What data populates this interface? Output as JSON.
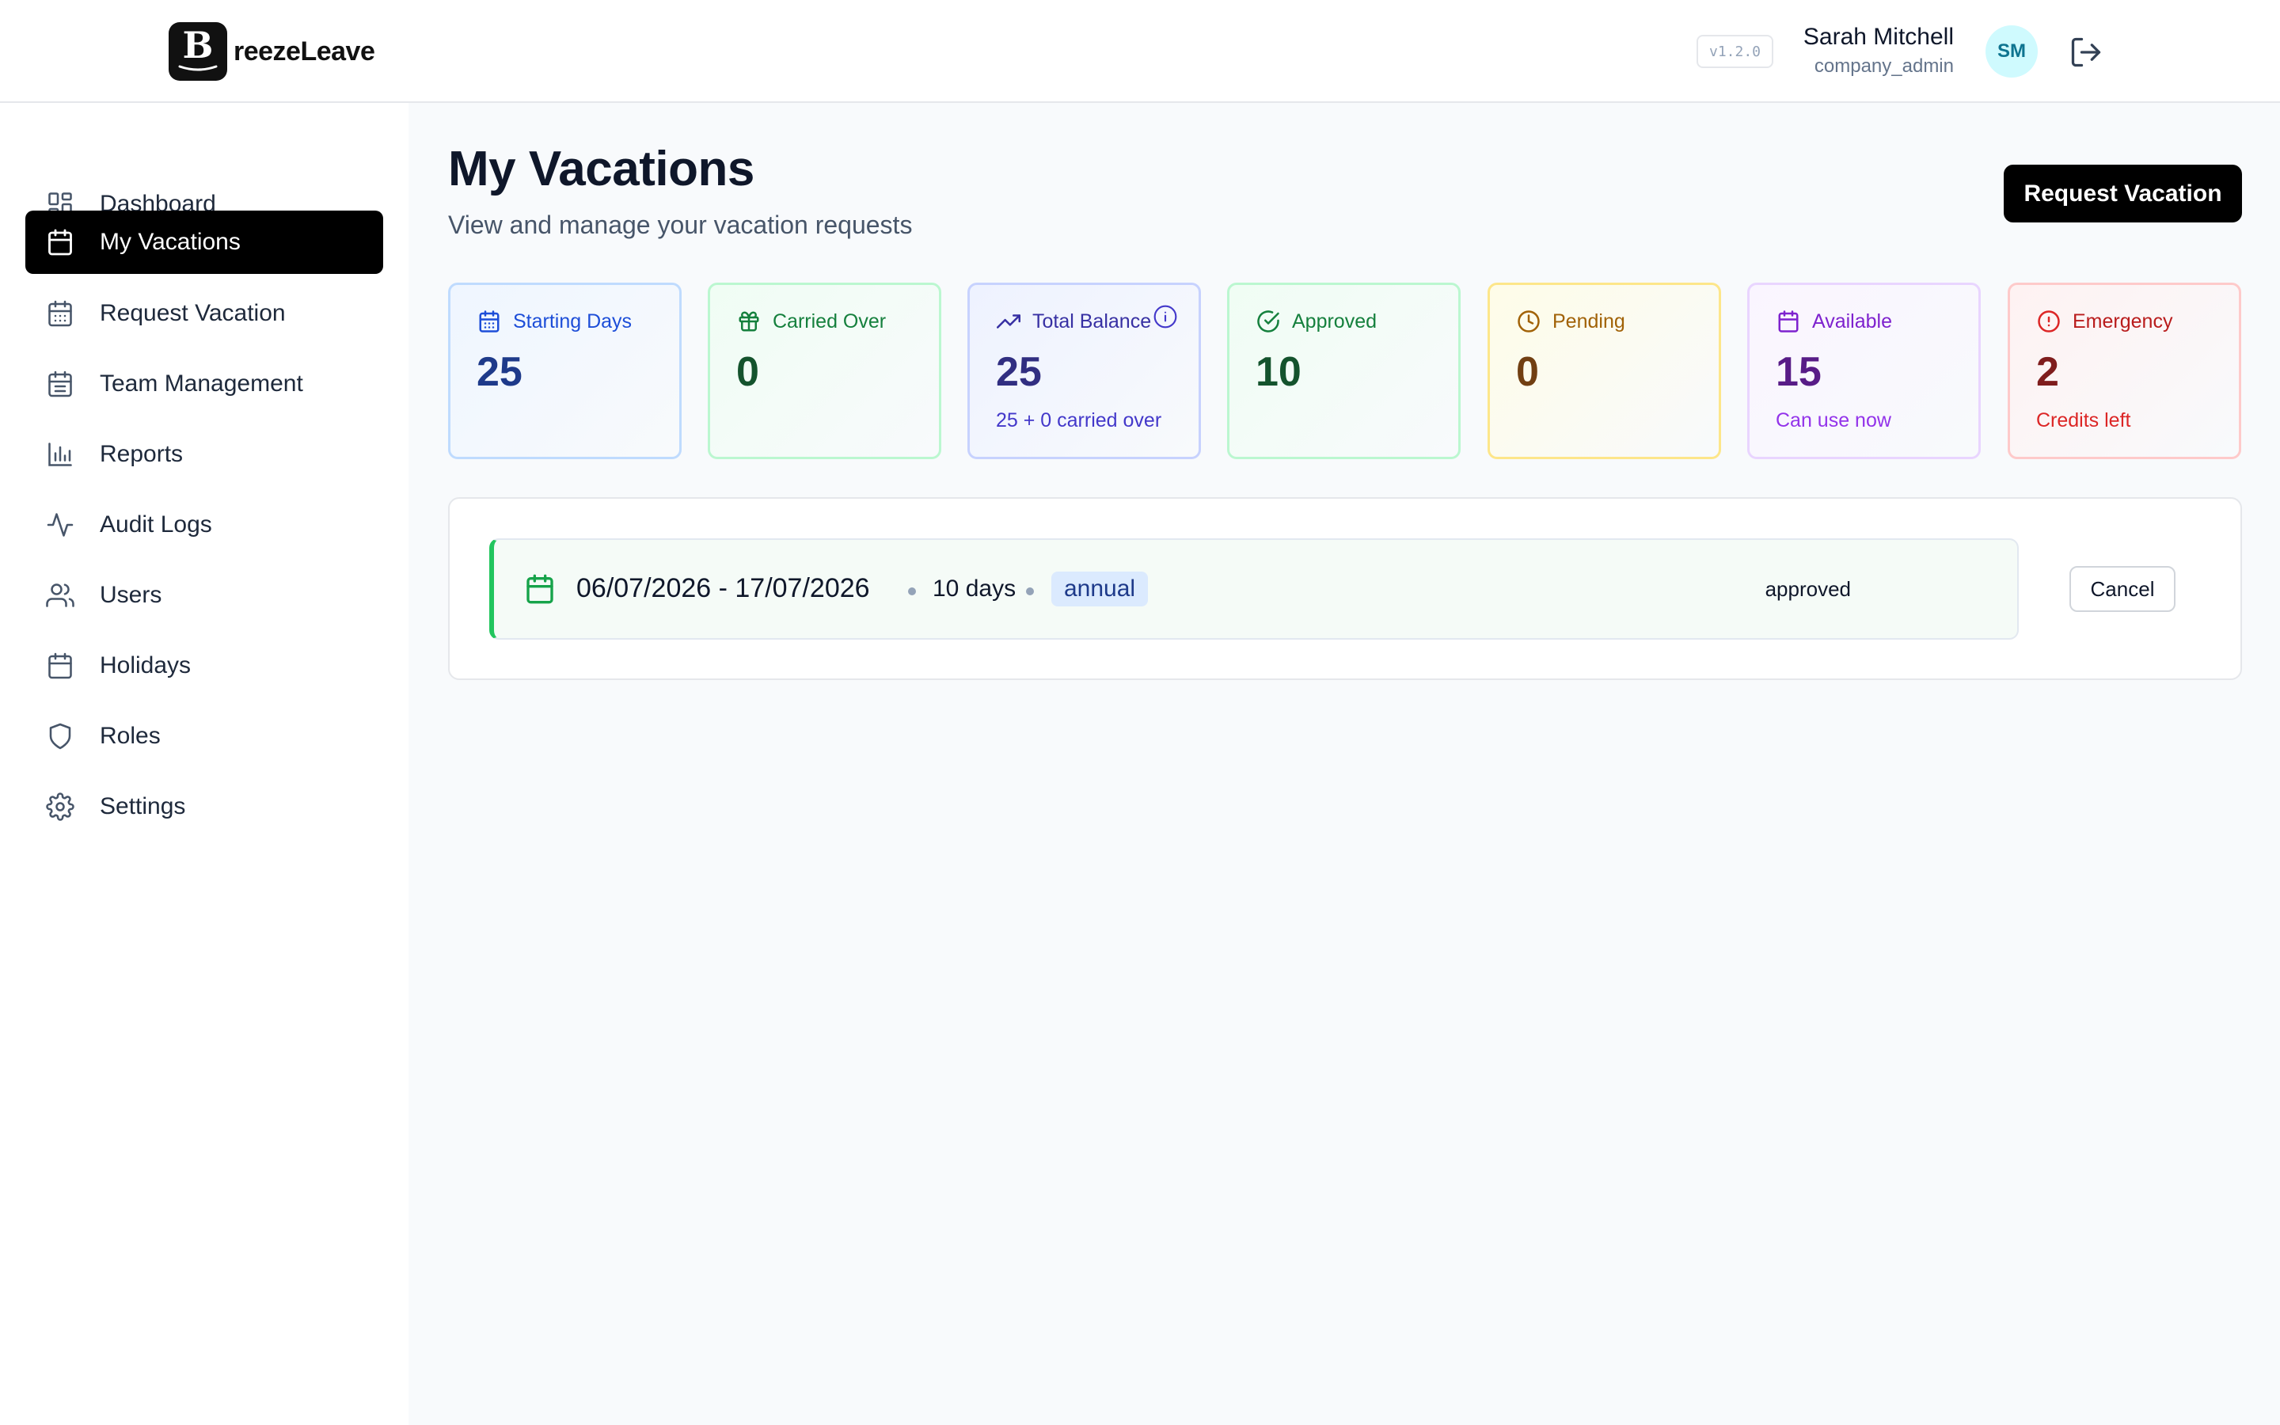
{
  "header": {
    "logo_letter": "B",
    "logo_text": "reezeLeave",
    "version": "v1.2.0",
    "user_name": "Sarah Mitchell",
    "user_role": "company_admin",
    "avatar_initials": "SM"
  },
  "sidebar": {
    "items": [
      {
        "label": "Dashboard",
        "icon": "dashboard-icon",
        "active": false
      },
      {
        "label": "My Vacations",
        "icon": "calendar-icon",
        "active": true
      },
      {
        "label": "Request Vacation",
        "icon": "calendar-days-icon",
        "active": false
      },
      {
        "label": "Team Management",
        "icon": "calendar-days-icon",
        "active": false
      },
      {
        "label": "Reports",
        "icon": "bar-chart-icon",
        "active": false
      },
      {
        "label": "Audit Logs",
        "icon": "activity-icon",
        "active": false
      },
      {
        "label": "Users",
        "icon": "users-icon",
        "active": false
      },
      {
        "label": "Holidays",
        "icon": "calendar-icon",
        "active": false
      },
      {
        "label": "Roles",
        "icon": "shield-icon",
        "active": false
      },
      {
        "label": "Settings",
        "icon": "gear-icon",
        "active": false
      }
    ]
  },
  "main": {
    "title": "My Vacations",
    "subtitle": "View and manage your vacation requests",
    "request_button": "Request Vacation",
    "cards": [
      {
        "label": "Starting Days",
        "value": "25",
        "sub": "",
        "icon": "calendar-icon",
        "color": "#1d4ed8"
      },
      {
        "label": "Carried Over",
        "value": "0",
        "sub": "",
        "icon": "gift-icon",
        "color": "#15803d"
      },
      {
        "label": "Total Balance",
        "value": "25",
        "sub": "25 + 0 carried over",
        "icon": "trending-up-icon",
        "color": "#3730a3"
      },
      {
        "label": "Approved",
        "value": "10",
        "sub": "",
        "icon": "check-circle-icon",
        "color": "#15803d"
      },
      {
        "label": "Pending",
        "value": "0",
        "sub": "",
        "icon": "clock-icon",
        "color": "#a16207"
      },
      {
        "label": "Available",
        "value": "15",
        "sub": "Can use now",
        "icon": "calendar-icon",
        "color": "#7e22ce"
      },
      {
        "label": "Emergency",
        "value": "2",
        "sub": "Credits left",
        "icon": "alert-circle-icon",
        "color": "#dc2626"
      }
    ],
    "vacations": [
      {
        "dates": "06/07/2026 - 17/07/2026",
        "days": "10 days",
        "type": "annual",
        "status": "approved",
        "action": "Cancel"
      }
    ]
  }
}
